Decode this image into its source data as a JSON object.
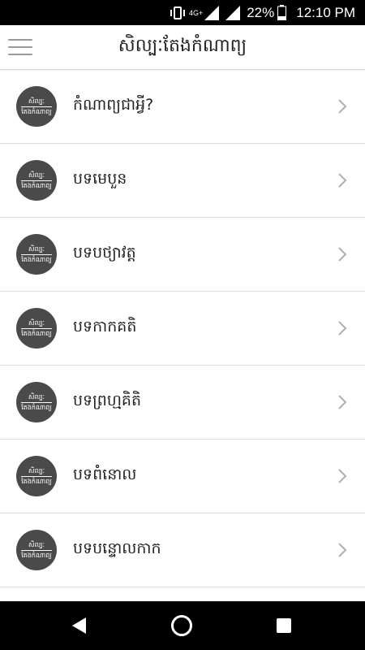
{
  "status_bar": {
    "network": "4G+",
    "battery": "22%",
    "time": "12:10 PM"
  },
  "header": {
    "title": "សិល្បៈតែងកំណាព្យ"
  },
  "avatar": {
    "line1": "សិល្បៈ",
    "line2": "តែងកំណាព្យ"
  },
  "list": {
    "items": [
      {
        "label": "កំណាព្យជាអ្វី?"
      },
      {
        "label": "បទមេបួន"
      },
      {
        "label": "បទបថ្យាវត្ត"
      },
      {
        "label": "បទកាកគតិ"
      },
      {
        "label": "បទព្រហ្មគិតិ"
      },
      {
        "label": "បទពំនោល"
      },
      {
        "label": "បទបន្ទោលកាក"
      }
    ]
  },
  "icons": {
    "menu": "hamburger-menu-icon",
    "chevron": "chevron-right-icon",
    "back": "back-triangle-icon",
    "home": "home-circle-icon",
    "recent": "recent-apps-square-icon"
  }
}
